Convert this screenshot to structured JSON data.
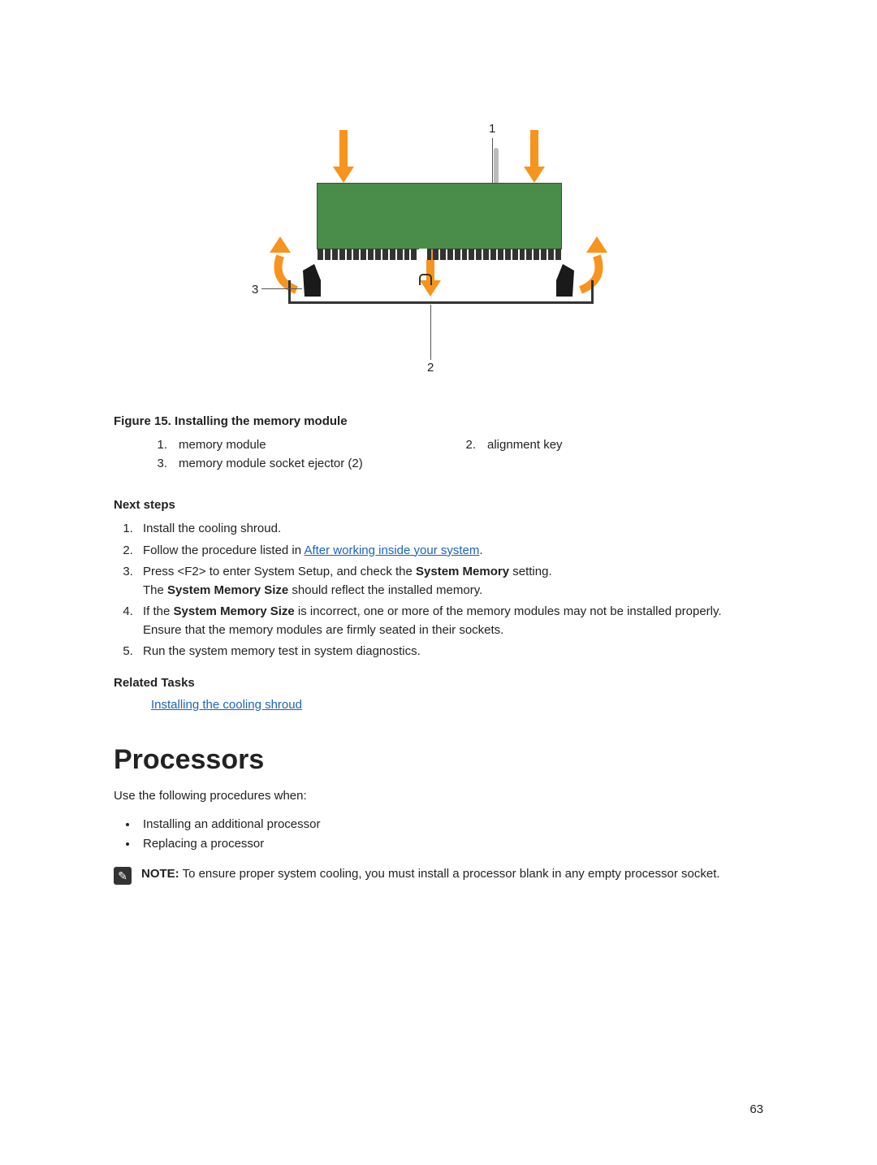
{
  "figure": {
    "callouts": {
      "c1": "1",
      "c2": "2",
      "c3": "3"
    },
    "caption": "Figure 15. Installing the memory module",
    "legend": {
      "i1": {
        "num": "1.",
        "text": "memory module"
      },
      "i2": {
        "num": "2.",
        "text": "alignment key"
      },
      "i3": {
        "num": "3.",
        "text": "memory module socket ejector (2)"
      }
    }
  },
  "nextSteps": {
    "heading": "Next steps",
    "s1": "Install the cooling shroud.",
    "s2a": "Follow the procedure listed in ",
    "s2link": "After working inside your system",
    "s2b": ".",
    "s3a": "Press <F2> to enter System Setup, and check the ",
    "s3bold": "System Memory",
    "s3b": " setting.",
    "s3line2a": "The ",
    "s3line2bold": "System Memory Size",
    "s3line2b": " should reflect the installed memory.",
    "s4a": "If the ",
    "s4bold": "System Memory Size",
    "s4b": " is incorrect, one or more of the memory modules may not be installed properly. Ensure that the memory modules are firmly seated in their sockets.",
    "s5": "Run the system memory test in system diagnostics."
  },
  "relatedTasks": {
    "heading": "Related Tasks",
    "link": "Installing the cooling shroud"
  },
  "processors": {
    "heading": "Processors",
    "intro": "Use the following procedures when:",
    "b1": "Installing an additional processor",
    "b2": "Replacing a processor",
    "noteLabel": "NOTE:",
    "noteText": " To ensure proper system cooling, you must install a processor blank in any empty processor socket."
  },
  "pageNumber": "63"
}
